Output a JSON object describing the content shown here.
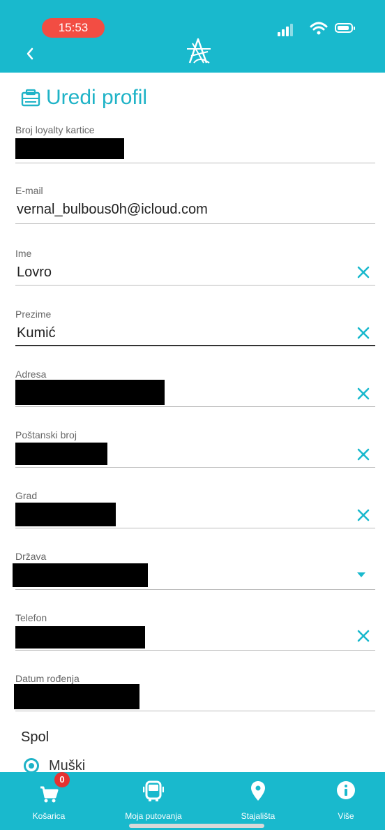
{
  "status_bar": {
    "time": "15:53"
  },
  "header": {
    "logo_icon": "app-logo-icon"
  },
  "page_title": {
    "text": "Uredi profil",
    "icon": "profile-card-icon"
  },
  "fields": [
    {
      "label": "Broj loyalty kartice",
      "value": "",
      "redacted": true,
      "clearable": false
    },
    {
      "label": "E-mail",
      "value": "vernal_bulbous0h@icloud.com",
      "redacted": false,
      "clearable": false
    },
    {
      "label": "Ime",
      "value": "Lovro",
      "redacted": false,
      "clearable": true
    },
    {
      "label": "Prezime",
      "value": "Kumić",
      "redacted": false,
      "clearable": true
    },
    {
      "label": "Adresa",
      "value": "",
      "redacted": true,
      "clearable": true
    },
    {
      "label": "Poštanski broj",
      "value": "",
      "redacted": true,
      "clearable": true
    },
    {
      "label": "Grad",
      "value": "",
      "redacted": true,
      "clearable": true
    },
    {
      "label": "Država",
      "value": "",
      "redacted": true,
      "dropdown": true
    },
    {
      "label": "Telefon",
      "value": "",
      "redacted": true,
      "clearable": true
    },
    {
      "label": "Datum rođenja",
      "value": "",
      "redacted": true,
      "clearable": false
    }
  ],
  "gender": {
    "label": "Spol",
    "options": [
      "Muški"
    ],
    "selected": "Muški"
  },
  "bottom_nav": {
    "items": [
      {
        "label": "Košarica",
        "icon": "cart-icon",
        "badge": "0"
      },
      {
        "label": "Moja putovanja",
        "icon": "bus-icon"
      },
      {
        "label": "Stajališta",
        "icon": "location-pin-icon"
      },
      {
        "label": "Više",
        "icon": "info-icon"
      }
    ]
  },
  "colors": {
    "accent": "#19b9cd",
    "badge": "#e63131",
    "time_pill": "#f24d43"
  }
}
